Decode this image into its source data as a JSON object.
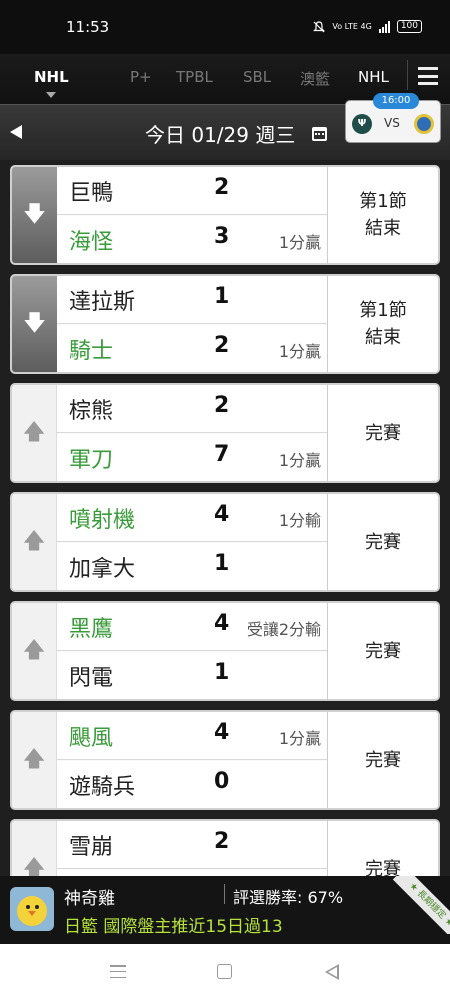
{
  "status_bar": {
    "time": "11:53",
    "network_label": "Vo LTE 4G",
    "battery": "100"
  },
  "tabs": [
    {
      "label": "NHL",
      "active": true
    },
    {
      "label": "P+"
    },
    {
      "label": "TPBL"
    },
    {
      "label": "SBL"
    },
    {
      "label": "澳籃"
    },
    {
      "label": "NHL"
    }
  ],
  "date_bar": {
    "date_label": "今日 01/29 週三"
  },
  "upcoming": {
    "time": "16:00",
    "vs": "VS",
    "team_a_logo": "Ψ"
  },
  "games": [
    {
      "expanded": true,
      "status": [
        "第1節",
        "結束"
      ],
      "away": {
        "name": "巨鴨",
        "score": "2",
        "result": "",
        "win": false
      },
      "home": {
        "name": "海怪",
        "score": "3",
        "result": "1分贏",
        "win": true
      }
    },
    {
      "expanded": true,
      "status": [
        "第1節",
        "結束"
      ],
      "away": {
        "name": "達拉斯",
        "score": "1",
        "result": "",
        "win": false
      },
      "home": {
        "name": "騎士",
        "score": "2",
        "result": "1分贏",
        "win": true
      }
    },
    {
      "expanded": false,
      "status": [
        "完賽"
      ],
      "away": {
        "name": "棕熊",
        "score": "2",
        "result": "",
        "win": false
      },
      "home": {
        "name": "軍刀",
        "score": "7",
        "result": "1分贏",
        "win": true
      }
    },
    {
      "expanded": false,
      "status": [
        "完賽"
      ],
      "away": {
        "name": "噴射機",
        "score": "4",
        "result": "1分輸",
        "win": true
      },
      "home": {
        "name": "加拿大",
        "score": "1",
        "result": "",
        "win": false
      }
    },
    {
      "expanded": false,
      "status": [
        "完賽"
      ],
      "away": {
        "name": "黑鷹",
        "score": "4",
        "result": "受讓2分輸",
        "win": true
      },
      "home": {
        "name": "閃電",
        "score": "1",
        "result": "",
        "win": false
      }
    },
    {
      "expanded": false,
      "status": [
        "完賽"
      ],
      "away": {
        "name": "颶風",
        "score": "4",
        "result": "1分贏",
        "win": true
      },
      "home": {
        "name": "遊騎兵",
        "score": "0",
        "result": "",
        "win": false
      }
    },
    {
      "expanded": false,
      "status": [
        "完賽"
      ],
      "away": {
        "name": "雪崩",
        "score": "2",
        "result": "",
        "win": false
      },
      "home": {
        "name": "",
        "score": "",
        "result": "",
        "win": false
      }
    }
  ],
  "promo": {
    "name": "神奇雞",
    "win_rate": "評選勝率: 67%",
    "message": "日籃 國際盤主推近15日過13",
    "ribbon": "★ 長期穩定 ★"
  },
  "icons": {
    "collapse": "arrow-down-icon",
    "expand": "arrow-up-icon",
    "prev": "chevron-left-icon",
    "calendar": "calendar-icon",
    "menu": "hamburger-menu-icon"
  },
  "colors": {
    "win_green": "#3a9b3a",
    "promo_green": "#b6e23a",
    "chip_blue": "#2a88d8"
  }
}
